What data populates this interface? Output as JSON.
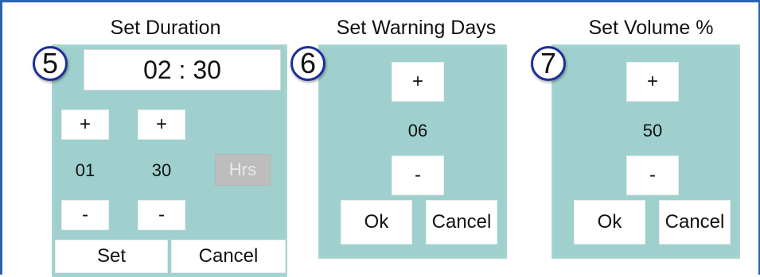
{
  "duration": {
    "title": "Set Duration",
    "marker": "5",
    "display": "02 : 30",
    "hours": {
      "plus": "+",
      "value": "01",
      "minus": "-"
    },
    "minutes": {
      "plus": "+",
      "value": "30",
      "minus": "-"
    },
    "unit_label": "Hrs",
    "set_label": "Set",
    "cancel_label": "Cancel"
  },
  "warning": {
    "title": "Set Warning Days",
    "marker": "6",
    "plus": "+",
    "value": "06",
    "minus": "-",
    "ok_label": "Ok",
    "cancel_label": "Cancel"
  },
  "volume": {
    "title": "Set Volume %",
    "marker": "7",
    "plus": "+",
    "value": "50",
    "minus": "-",
    "ok_label": "Ok",
    "cancel_label": "Cancel"
  },
  "colors": {
    "panel": "#9fd0cd",
    "frame_border": "#2a62b0",
    "marker_ring": "#1c2f9a"
  }
}
